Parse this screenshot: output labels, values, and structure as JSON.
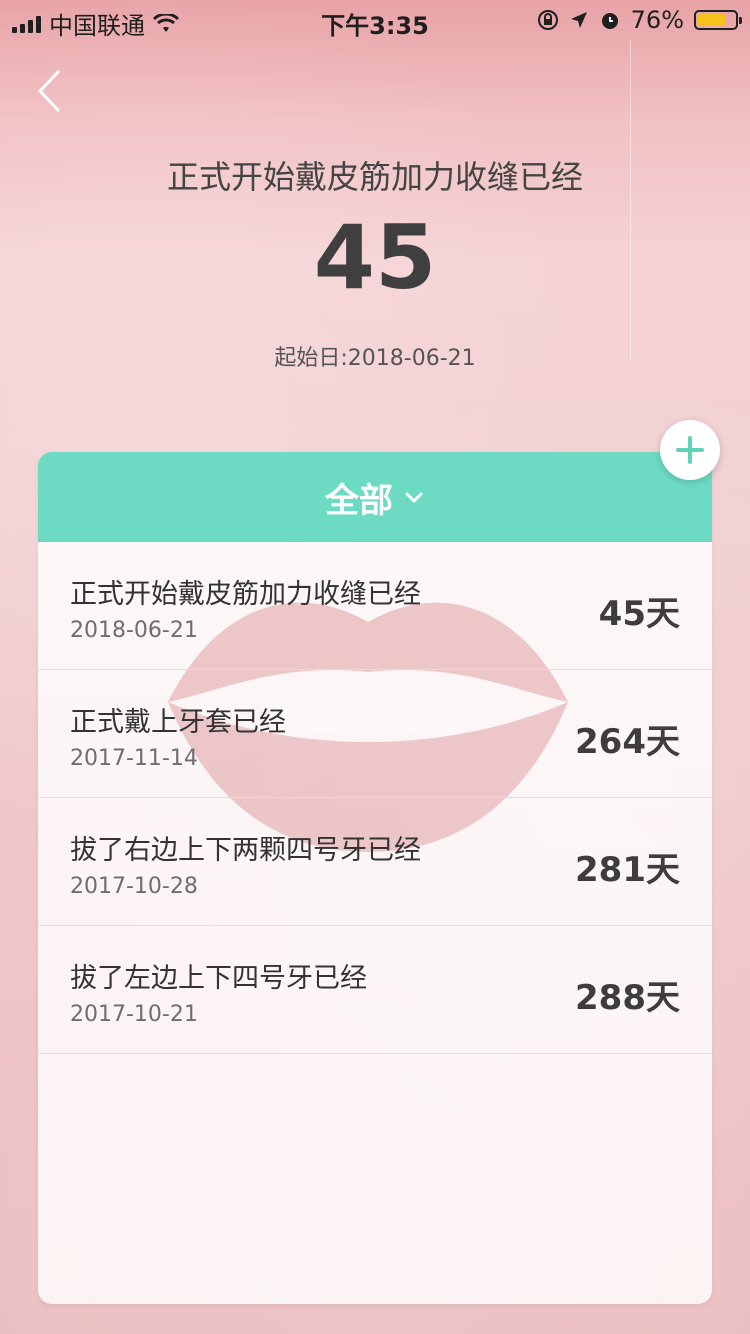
{
  "status_bar": {
    "carrier": "中国联通",
    "time": "下午3:35",
    "battery": "76%",
    "battery_level": 0.76
  },
  "header": {
    "title": "正式开始戴皮筋加力收缝已经",
    "count": "45",
    "start_date": "起始日:2018-06-21"
  },
  "filter": {
    "label": "全部"
  },
  "items": [
    {
      "title": "正式开始戴皮筋加力收缝已经",
      "date": "2018-06-21",
      "days": "45天"
    },
    {
      "title": "正式戴上牙套已经",
      "date": "2017-11-14",
      "days": "264天"
    },
    {
      "title": "拔了右边上下两颗四号牙已经",
      "date": "2017-10-28",
      "days": "281天"
    },
    {
      "title": "拔了左边上下四号牙已经",
      "date": "2017-10-21",
      "days": "288天"
    }
  ],
  "colors": {
    "accent": "#6ddbc4",
    "battery": "#f7c21b"
  }
}
